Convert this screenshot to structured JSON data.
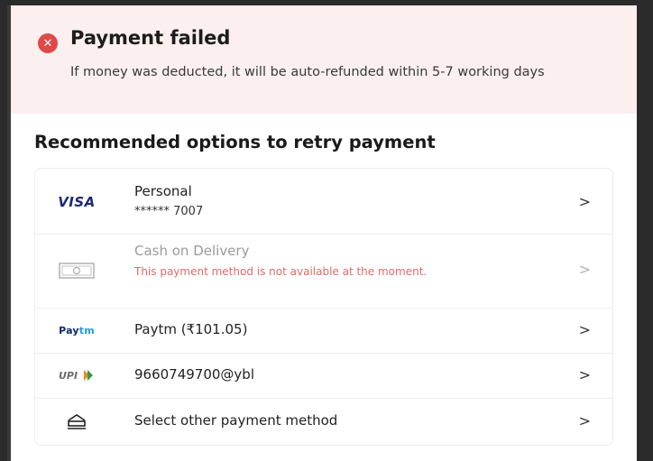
{
  "banner": {
    "title": "Payment failed",
    "message": "If money was deducted, it will be auto-refunded within 5-7 working days"
  },
  "section_title": "Recommended options to retry payment",
  "options": [
    {
      "logo": "VISA",
      "title": "Personal",
      "subtitle": "****** 7007",
      "chevron": ">"
    },
    {
      "logo_icon": "cash-icon",
      "title": "Cash on Delivery",
      "error": "This payment method is not available at the moment.",
      "chevron": ">",
      "disabled": true
    },
    {
      "logo_part1": "Pay",
      "logo_part2": "tm",
      "title": "Paytm (₹101.05)",
      "chevron": ">"
    },
    {
      "logo": "UPI",
      "title": "9660749700@ybl",
      "chevron": ">"
    },
    {
      "logo_icon": "card-stack-icon",
      "title": "Select other payment method",
      "chevron": ">"
    }
  ],
  "colors": {
    "error": "#e04848",
    "banner_bg": "#fbefef",
    "error_text": "#e06a6a"
  }
}
